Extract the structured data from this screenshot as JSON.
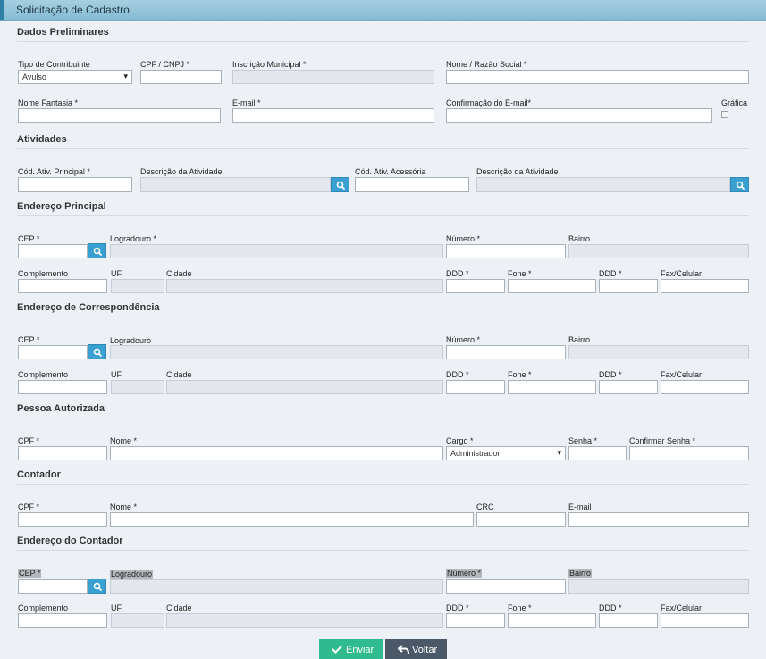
{
  "header": {
    "title": "Solicitação de Cadastro"
  },
  "sections": {
    "preliminares": "Dados Preliminares",
    "atividades": "Atividades",
    "endereco_principal": "Endereço Principal",
    "endereco_correspondencia": "Endereço de Correspondência",
    "pessoa_autorizada": "Pessoa Autorizada",
    "contador": "Contador",
    "endereco_contador": "Endereço do Contador"
  },
  "preliminares": {
    "tipo_label": "Tipo de Contribuinte",
    "tipo_value": "Avulso",
    "cpf_cnpj_label": "CPF / CNPJ *",
    "inscricao_label": "Inscrição Municipal *",
    "nome_label": "Nome / Razão Social *",
    "fantasia_label": "Nome Fantasia *",
    "email_label": "E-mail *",
    "confirm_email_label": "Confirmação do E-mail*",
    "grafica_label": "Gráfica"
  },
  "atividades": {
    "cod_principal_label": "Cód. Ativ. Principal *",
    "desc1_label": "Descrição da Atividade",
    "cod_acessoria_label": "Cód. Ativ. Acessória",
    "desc2_label": "Descrição da Atividade"
  },
  "endereco_principal": {
    "cep": "CEP *",
    "logradouro": "Logradouro *",
    "numero": "Número *",
    "bairro": "Bairro",
    "complemento": "Complemento",
    "uf": "UF",
    "cidade": "Cidade",
    "ddd1": "DDD *",
    "fone": "Fone *",
    "ddd2": "DDD *",
    "fax": "Fax/Celular"
  },
  "endereco_correspondencia": {
    "cep": "CEP *",
    "logradouro": "Logradouro",
    "numero": "Número *",
    "bairro": "Bairro",
    "complemento": "Complemento",
    "uf": "UF",
    "cidade": "Cidade",
    "ddd1": "DDD *",
    "fone": "Fone *",
    "ddd2": "DDD *",
    "fax": "Fax/Celular"
  },
  "pessoa_autorizada": {
    "cpf": "CPF *",
    "nome": "Nome *",
    "cargo": "Cargo *",
    "cargo_value": "Administrador",
    "senha": "Senha *",
    "confirmar_senha": "Confirmar Senha *"
  },
  "contador": {
    "cpf": "CPF *",
    "nome": "Nome *",
    "crc": "CRC",
    "email": "E-mail"
  },
  "endereco_contador": {
    "cep": "CEP *",
    "logradouro": "Logradouro",
    "numero": "Número *",
    "bairro": "Bairro",
    "complemento": "Complemento",
    "uf": "UF",
    "cidade": "Cidade",
    "ddd1": "DDD *",
    "fone": "Fone *",
    "ddd2": "DDD *",
    "fax": "Fax/Celular"
  },
  "actions": {
    "enviar": "Enviar",
    "voltar": "Voltar"
  },
  "icons": {
    "search": "search-icon",
    "check": "check-icon",
    "back": "back-arrow-icon",
    "dropdown": "chevron-down-icon"
  },
  "colors": {
    "header": "#8fc2d8",
    "search_button": "#3a9fd1",
    "send_button": "#2fbb8d",
    "back_button": "#4a5868"
  }
}
